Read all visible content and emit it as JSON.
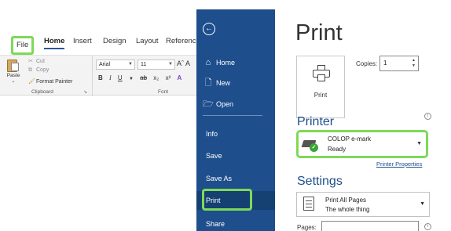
{
  "ribbon": {
    "tabs": [
      "File",
      "Home",
      "Insert",
      "Design",
      "Layout",
      "Referenc"
    ],
    "clipboard": {
      "paste_label": "Paste",
      "cut_label": "Cut",
      "copy_label": "Copy",
      "format_painter_label": "Format Painter",
      "group_label": "Clipboard"
    },
    "font": {
      "font_name": "Arial",
      "font_size": "11",
      "grow_shrink": "Aˆ A",
      "group_label": "Font"
    },
    "highlight_color": "#7ed957"
  },
  "backstage": {
    "nav_color": "#1e4e8c",
    "items": [
      {
        "label": "Home",
        "icon": "home-icon"
      },
      {
        "label": "New",
        "icon": "new-document-icon"
      },
      {
        "label": "Open",
        "icon": "folder-open-icon"
      },
      {
        "label": "Info"
      },
      {
        "label": "Save"
      },
      {
        "label": "Save As"
      },
      {
        "label": "Print"
      },
      {
        "label": "Share"
      }
    ]
  },
  "print": {
    "title": "Print",
    "print_button_label": "Print",
    "copies_label": "Copies:",
    "copies_value": "1",
    "printer_heading": "Printer",
    "printer_name": "COLOP e-mark",
    "printer_status": "Ready",
    "printer_properties_label": "Printer Properties",
    "settings_heading": "Settings",
    "settings_main": "Print All Pages",
    "settings_sub": "The whole thing",
    "pages_label": "Pages:",
    "pages_value": ""
  }
}
